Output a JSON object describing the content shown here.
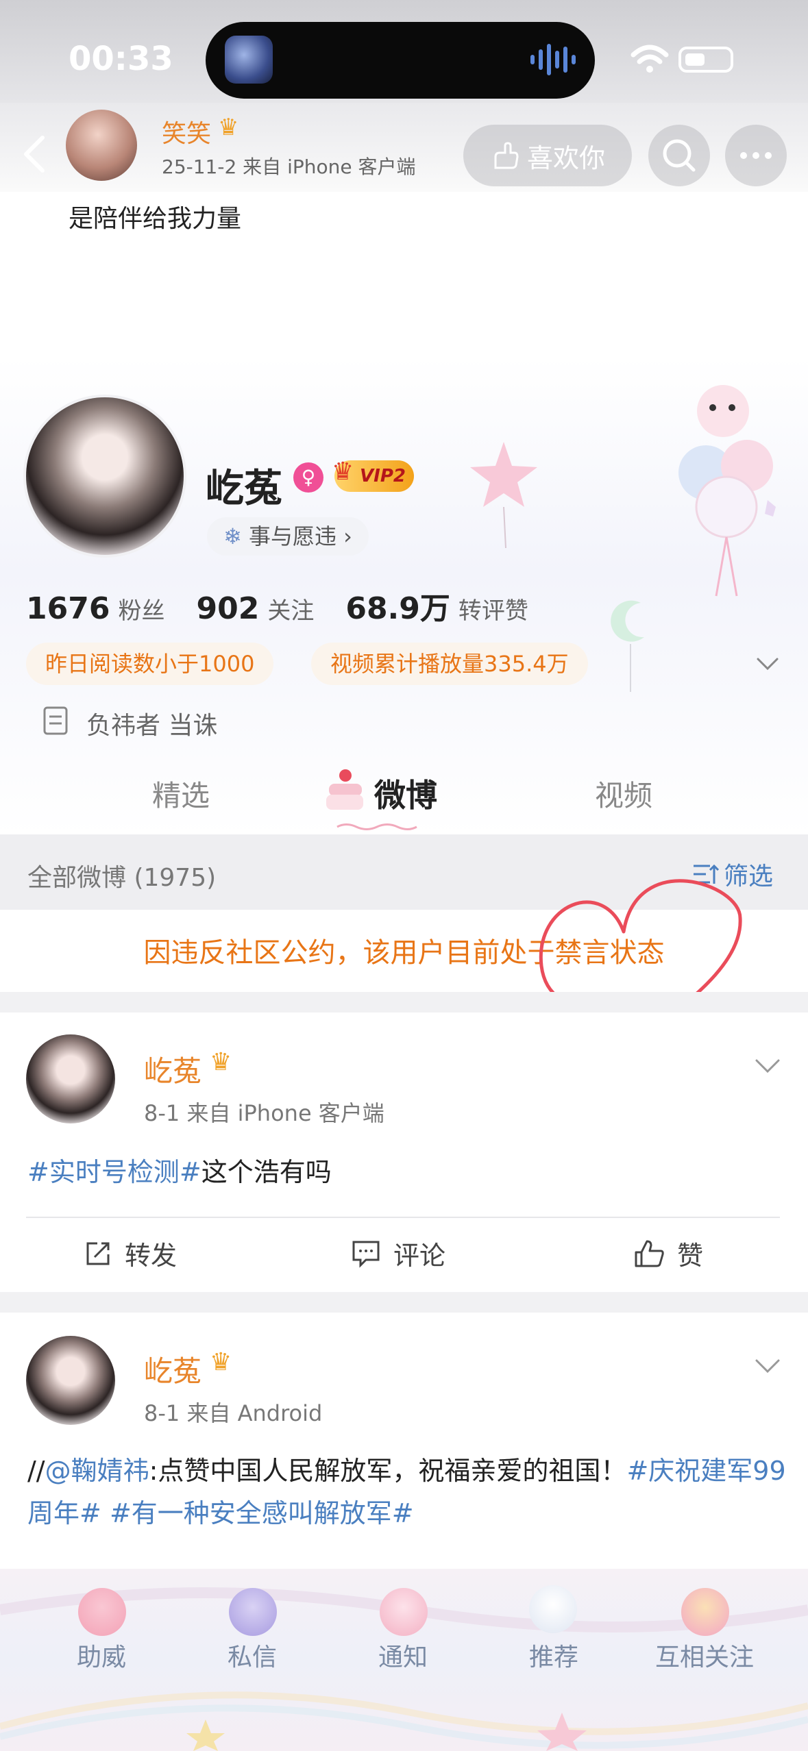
{
  "status_bar": {
    "time": "00:33"
  },
  "header": {
    "user_name": "笑笑",
    "meta": "25-11-2  来自 iPhone 客户端",
    "like_label": "喜欢你",
    "quote": "是陪伴给我力量"
  },
  "profile": {
    "name": "屹菟",
    "vip_label": "VIP2",
    "tag_label": "事与愿违 ›",
    "stats": [
      {
        "value": "1676",
        "label": "粉丝"
      },
      {
        "value": "902",
        "label": "关注"
      },
      {
        "value": "68.9万",
        "label": "转评赞"
      }
    ],
    "badges": [
      "昨日阅读数小于1000",
      "视频累计播放量335.4万"
    ],
    "bio": "负祎者 当诛"
  },
  "tabs": [
    "精选",
    "微博",
    "视频"
  ],
  "filter": {
    "count_label": "全部微博 (1975)",
    "button_label": "筛选"
  },
  "ban_notice": "因违反社区公约，该用户目前处于禁言状态",
  "posts": [
    {
      "author": "屹菟",
      "meta": "8-1  来自 iPhone 客户端",
      "topic": "#实时号检测#",
      "text": "这个浩有吗",
      "actions": [
        "转发",
        "评论",
        "赞"
      ]
    },
    {
      "author": "屹菟",
      "meta": "8-1  来自 Android",
      "prefix": "//",
      "mention": "@鞠婧祎",
      "text": ":点赞中国人民解放军，祝福亲爱的祖国！",
      "topic1": "#庆祝建军99周年#",
      "topic2": "#有一种安全感叫解放军#"
    }
  ],
  "bottom_nav": [
    "助威",
    "私信",
    "通知",
    "推荐",
    "互相关注"
  ],
  "colors": {
    "accent_orange": "#e87516",
    "link_blue": "#4a7fc0",
    "name_orange": "#e8852b"
  }
}
